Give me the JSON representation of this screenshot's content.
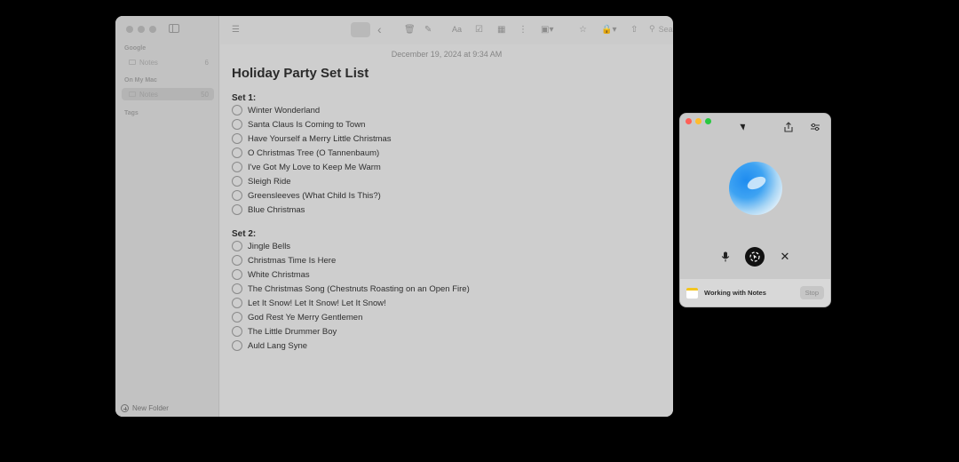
{
  "sidebar": {
    "sections": [
      {
        "title": "Google",
        "folders": [
          {
            "name": "Notes",
            "count": "6",
            "selected": false
          }
        ]
      },
      {
        "title": "On My Mac",
        "folders": [
          {
            "name": "Notes",
            "count": "50",
            "selected": true
          }
        ]
      },
      {
        "title": "Tags",
        "folders": []
      }
    ],
    "new_folder_label": "New Folder"
  },
  "toolbar": {
    "icons": [
      "list-view-icon",
      "gallery-view-icon",
      "back-icon",
      "trash-icon",
      "compose-icon",
      "format-icon",
      "checklist-icon",
      "table-icon",
      "audio-icon",
      "media-icon",
      "collaborate-icon",
      "lock-icon",
      "share-icon",
      "search-icon"
    ],
    "search_placeholder": "Search"
  },
  "note": {
    "date": "December 19, 2024 at 9:34 AM",
    "title": "Holiday Party Set List",
    "set1_heading": "Set 1:",
    "set1_items": [
      "Winter Wonderland",
      "Santa Claus Is Coming to Town",
      "Have Yourself a Merry Little Christmas",
      "O Christmas Tree (O Tannenbaum)",
      "I've Got My Love to Keep Me Warm",
      "Sleigh Ride",
      "Greensleeves (What Child Is This?)",
      "Blue Christmas"
    ],
    "set2_heading": "Set 2:",
    "set2_items": [
      "Jingle Bells",
      "Christmas Time Is Here",
      "White Christmas",
      "The Christmas Song (Chestnuts Roasting on an Open Fire)",
      "Let It Snow! Let It Snow! Let It Snow!",
      "God Rest Ye Merry Gentlemen",
      "The Little Drummer Boy",
      "Auld Lang Syne"
    ]
  },
  "assistant_panel": {
    "traffic_colors": [
      "#ff5f57",
      "#febc2e",
      "#28c840"
    ],
    "task_label": "Working with Notes",
    "stop_label": "Stop"
  }
}
